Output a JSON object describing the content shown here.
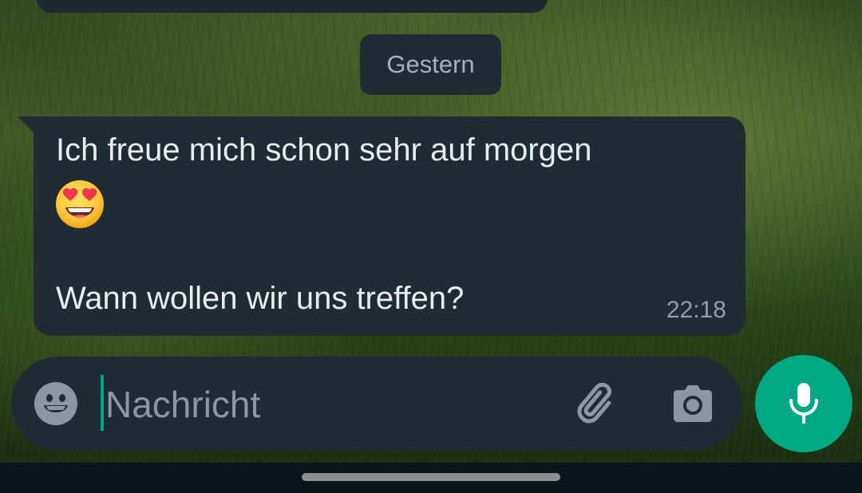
{
  "chat": {
    "date_separator": "Gestern",
    "message": {
      "line1": "Ich freue mich schon sehr auf morgen",
      "emoji": "heart-eyes-emoji",
      "line3": "Wann wollen wir uns treffen?",
      "time": "22:18"
    }
  },
  "composer": {
    "placeholder": "Nachricht",
    "icons": {
      "emoji": "emoji-icon",
      "attach": "paperclip-icon",
      "camera": "camera-icon",
      "mic": "microphone-icon"
    }
  },
  "colors": {
    "accent": "#00a884",
    "bubble": "#1f2c33",
    "text": "#e9edef",
    "meta": "#8f9ea7"
  }
}
